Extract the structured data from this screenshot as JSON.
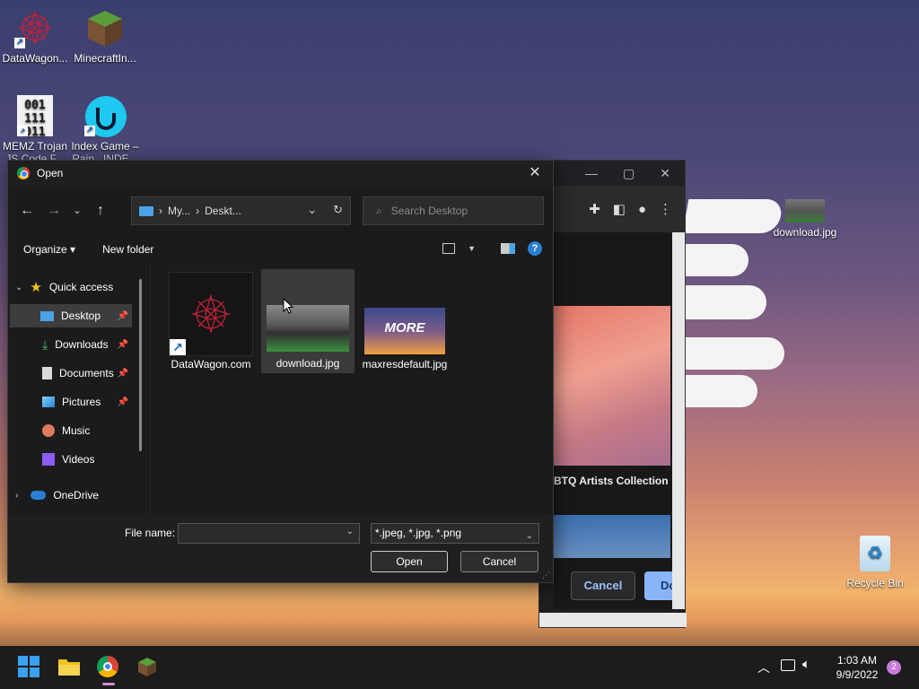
{
  "desktop": {
    "icons": [
      {
        "label": "DataWagon...",
        "icon": "datawagon-icon"
      },
      {
        "label": "MinecraftIn...",
        "icon": "minecraft-icon"
      },
      {
        "label": "MEMZ Trojan",
        "sub": "JS Code F...",
        "icon": "memz-icon"
      },
      {
        "label": "Index Game –",
        "sub": "Rain...INDE...",
        "icon": "index-game-icon"
      }
    ],
    "download_icon_label": "download.jpg",
    "recycle_bin_label": "Recycle Bin"
  },
  "browser": {
    "art_caption": "BTQ Artists Collection",
    "cancel_label": "Cancel",
    "done_label": "Do"
  },
  "dialog": {
    "title": "Open",
    "breadcrumb": [
      "My...",
      "Deskt..."
    ],
    "search_placeholder": "Search Desktop",
    "organize_label": "Organize ▾",
    "new_folder_label": "New folder",
    "help_label": "?",
    "sidebar": [
      {
        "label": "Quick access",
        "icon": "star-icon"
      },
      {
        "label": "Desktop",
        "icon": "desktop-folder-icon",
        "pinned": true,
        "selected": true
      },
      {
        "label": "Downloads",
        "icon": "downloads-folder-icon",
        "pinned": true
      },
      {
        "label": "Documents",
        "icon": "documents-folder-icon",
        "pinned": true
      },
      {
        "label": "Pictures",
        "icon": "pictures-folder-icon",
        "pinned": true
      },
      {
        "label": "Music",
        "icon": "music-folder-icon"
      },
      {
        "label": "Videos",
        "icon": "videos-folder-icon"
      },
      {
        "label": "OneDrive",
        "icon": "cloud-icon"
      }
    ],
    "files": [
      {
        "name": "DataWagon.com",
        "type": "shortcut"
      },
      {
        "name": "download.jpg",
        "type": "image",
        "selected": true
      },
      {
        "name": "maxresdefault.jpg",
        "type": "image",
        "thumb_text": "MORE"
      }
    ],
    "file_name_label": "File name:",
    "file_name_value": "",
    "filter_value": "*.jpeg, *.jpg, *.png",
    "open_label": "Open",
    "cancel_label": "Cancel"
  },
  "taskbar": {
    "time": "1:03 AM",
    "date": "9/9/2022",
    "notification_count": "2"
  },
  "colors": {
    "accent": "#2a7fd4",
    "chrome_blue": "#8ab4f8"
  }
}
